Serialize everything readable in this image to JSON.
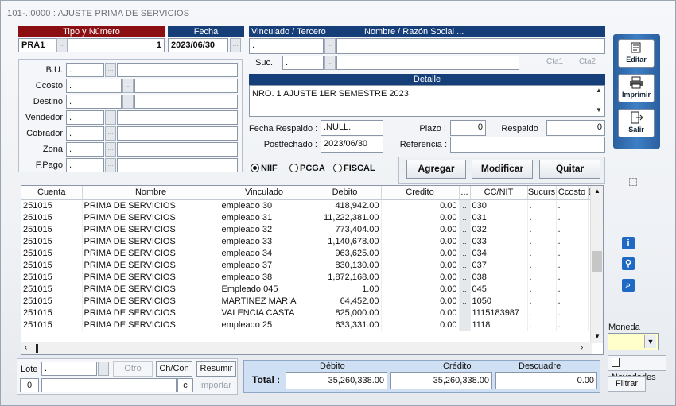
{
  "window": {
    "title": "101-.:0000 : AJUSTE PRIMA DE SERVICIOS"
  },
  "header": {
    "tipo_numero_label": "Tipo y Número",
    "tipo": "PRA1",
    "numero": "1",
    "fecha_label": "Fecha",
    "fecha": "2023/06/30",
    "vinculado_label": "Vinculado / Tercero",
    "nombre_label": "Nombre / Razón Social ...",
    "vinculado_value": ".",
    "nombre_value": "",
    "suc_label": "Suc.",
    "suc_value": ".",
    "cta1_label": "Cta1",
    "cta2_label": "Cta2"
  },
  "left_fields": [
    {
      "label": "B.U.",
      "value": "."
    },
    {
      "label": "Ccosto",
      "value": "."
    },
    {
      "label": "Destino",
      "value": "."
    },
    {
      "label": "Vendedor",
      "value": "."
    },
    {
      "label": "Cobrador",
      "value": "."
    },
    {
      "label": "Zona",
      "value": "."
    },
    {
      "label": "F.Pago",
      "value": "."
    }
  ],
  "detalle": {
    "label": "Detalle",
    "text": "NRO. 1 AJUSTE 1ER SEMESTRE 2023"
  },
  "extra": {
    "fecha_respaldo_label": "Fecha Respaldo :",
    "fecha_respaldo": ".NULL.",
    "plazo_label": "Plazo :",
    "plazo": "0",
    "respaldo_label": "Respaldo :",
    "respaldo": "0",
    "postfechado_label": "Postfechado :",
    "postfechado": "2023/06/30",
    "referencia_label": "Referencia :",
    "referencia": ""
  },
  "radios": [
    {
      "label": "NIIF",
      "selected": true
    },
    {
      "label": "PCGA",
      "selected": false
    },
    {
      "label": "FISCAL",
      "selected": false
    }
  ],
  "actions": {
    "agregar": "Agregar",
    "modificar": "Modificar",
    "quitar": "Quitar"
  },
  "side_buttons": {
    "editar": "Editar",
    "imprimir": "Imprimir",
    "salir": "Salir"
  },
  "table": {
    "columns": [
      "Cuenta",
      "Nombre",
      "Vinculado",
      "Debito",
      "Credito",
      "...",
      "CC/NIT",
      "Sucurs",
      "Ccosto",
      "De"
    ],
    "rows": [
      [
        "251015",
        "PRIMA DE SERVICIOS",
        "empleado 30",
        "418,942.00",
        "0.00",
        "..",
        "030",
        ".",
        ".",
        "."
      ],
      [
        "251015",
        "PRIMA DE SERVICIOS",
        "empleado 31",
        "11,222,381.00",
        "0.00",
        "..",
        "031",
        ".",
        ".",
        "."
      ],
      [
        "251015",
        "PRIMA DE SERVICIOS",
        "empleado 32",
        "773,404.00",
        "0.00",
        "..",
        "032",
        ".",
        ".",
        "."
      ],
      [
        "251015",
        "PRIMA DE SERVICIOS",
        "empleado 33",
        "1,140,678.00",
        "0.00",
        "..",
        "033",
        ".",
        ".",
        "."
      ],
      [
        "251015",
        "PRIMA DE SERVICIOS",
        "empleado 34",
        "963,625.00",
        "0.00",
        "..",
        "034",
        ".",
        ".",
        "."
      ],
      [
        "251015",
        "PRIMA DE SERVICIOS",
        "empleado 37",
        "830,130.00",
        "0.00",
        "..",
        "037",
        ".",
        ".",
        "."
      ],
      [
        "251015",
        "PRIMA DE SERVICIOS",
        "empleado 38",
        "1,872,168.00",
        "0.00",
        "..",
        "038",
        ".",
        ".",
        "."
      ],
      [
        "251015",
        "PRIMA DE SERVICIOS",
        "Empleado 045",
        "1.00",
        "0.00",
        "..",
        "045",
        ".",
        ".",
        "."
      ],
      [
        "251015",
        "PRIMA DE SERVICIOS",
        "MARTINEZ MARIA",
        "64,452.00",
        "0.00",
        "..",
        "1050",
        ".",
        ".",
        "."
      ],
      [
        "251015",
        "PRIMA DE SERVICIOS",
        "VALENCIA CASTA",
        "825,000.00",
        "0.00",
        "..",
        "1115183987",
        ".",
        ".",
        "."
      ],
      [
        "251015",
        "PRIMA DE SERVICIOS",
        "empleado 25",
        "633,331.00",
        "0.00",
        "..",
        "1118",
        ".",
        ".",
        "."
      ]
    ]
  },
  "bottom": {
    "lote_label": "Lote",
    "lote_value": ".",
    "otro_label": "Otro",
    "chcon_label": "Ch/Con",
    "resumir_label": "Resumir",
    "counter": "0",
    "c_label": "c",
    "importar_label": "Importar"
  },
  "totals": {
    "total_label": "Total :",
    "debito_label": "Débito",
    "credito_label": "Crédito",
    "descuadre_label": "Descuadre",
    "debito": "35,260,338.00",
    "credito": "35,260,338.00",
    "descuadre": "0.00"
  },
  "right_panel": {
    "moneda_label": "Moneda",
    "novedades_label": "Novedades",
    "filtrar_label": "Filtrar"
  }
}
